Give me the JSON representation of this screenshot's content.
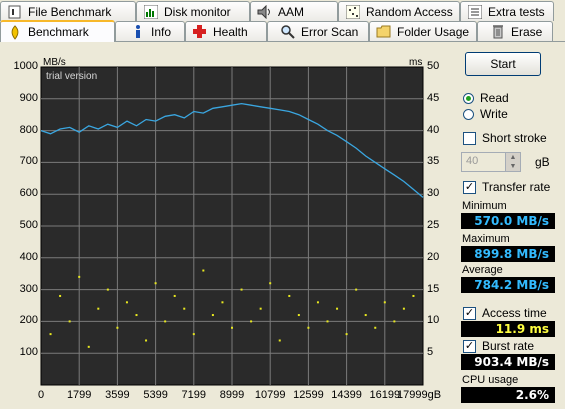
{
  "tabs_top": [
    {
      "label": "File Benchmark",
      "icon": "file-benchmark-icon"
    },
    {
      "label": "Disk monitor",
      "icon": "disk-monitor-icon"
    },
    {
      "label": "AAM",
      "icon": "speaker-icon"
    },
    {
      "label": "Random Access",
      "icon": "random-access-icon"
    },
    {
      "label": "Extra tests",
      "icon": "extra-tests-icon"
    }
  ],
  "tabs_bottom": [
    {
      "label": "Benchmark",
      "icon": "benchmark-icon",
      "active": true
    },
    {
      "label": "Info",
      "icon": "info-icon"
    },
    {
      "label": "Health",
      "icon": "health-cross-icon"
    },
    {
      "label": "Error Scan",
      "icon": "magnifier-icon"
    },
    {
      "label": "Folder Usage",
      "icon": "folder-icon"
    },
    {
      "label": "Erase",
      "icon": "trash-icon"
    }
  ],
  "chart": {
    "watermark": "trial version",
    "left_unit": "MB/s",
    "right_unit": "ms",
    "left_ticks": [
      "1000",
      "900",
      "800",
      "700",
      "600",
      "500",
      "400",
      "300",
      "200",
      "100"
    ],
    "right_ticks": [
      "50",
      "45",
      "40",
      "35",
      "30",
      "25",
      "20",
      "15",
      "10",
      "5"
    ],
    "x_ticks": [
      "0",
      "1799",
      "3599",
      "5399",
      "7199",
      "8999",
      "10799",
      "12599",
      "14399",
      "16199",
      "17999gB"
    ]
  },
  "chart_data": {
    "type": "line",
    "xlabel": "gB",
    "ylabel_left": "MB/s",
    "ylabel_right": "ms",
    "xlim": [
      0,
      18000
    ],
    "ylim_left": [
      0,
      1000
    ],
    "ylim_right": [
      0,
      50
    ],
    "grid": true,
    "series": [
      {
        "name": "Transfer rate",
        "axis": "left",
        "color": "#3aa6e0",
        "x": [
          0,
          450,
          900,
          1350,
          1800,
          2250,
          2700,
          3150,
          3600,
          4050,
          4500,
          4950,
          5400,
          5850,
          6300,
          6750,
          7200,
          7650,
          8100,
          8550,
          9000,
          9450,
          9900,
          10350,
          10800,
          11250,
          11700,
          12150,
          12600,
          13050,
          13500,
          13950,
          14400,
          14850,
          15300,
          15750,
          16200,
          16650,
          17100,
          17550,
          18000
        ],
        "y": [
          800,
          790,
          805,
          810,
          795,
          815,
          805,
          820,
          810,
          830,
          815,
          835,
          830,
          845,
          850,
          840,
          860,
          855,
          870,
          875,
          880,
          885,
          880,
          875,
          870,
          865,
          860,
          850,
          835,
          820,
          800,
          785,
          765,
          745,
          720,
          700,
          680,
          660,
          640,
          615,
          590
        ]
      },
      {
        "name": "Access time",
        "axis": "right",
        "color": "#e8e820",
        "type": "scatter",
        "x": [
          450,
          900,
          1350,
          1800,
          2250,
          2700,
          3150,
          3600,
          4050,
          4500,
          4950,
          5400,
          5850,
          6300,
          6750,
          7200,
          7650,
          8100,
          8550,
          9000,
          9450,
          9900,
          10350,
          10800,
          11250,
          11700,
          12150,
          12600,
          13050,
          13500,
          13950,
          14400,
          14850,
          15300,
          15750,
          16200,
          16650,
          17100,
          17550
        ],
        "y": [
          8,
          14,
          10,
          17,
          6,
          12,
          15,
          9,
          13,
          11,
          7,
          16,
          10,
          14,
          12,
          8,
          18,
          11,
          13,
          9,
          15,
          10,
          12,
          16,
          7,
          14,
          11,
          9,
          13,
          10,
          12,
          8,
          15,
          11,
          9,
          13,
          10,
          12,
          14
        ]
      }
    ]
  },
  "side": {
    "start": "Start",
    "read": "Read",
    "write": "Write",
    "short_stroke": "Short stroke",
    "stroke_value": "40",
    "stroke_unit": "gB",
    "transfer_rate": "Transfer rate",
    "minimum_label": "Minimum",
    "minimum": "570.0 MB/s",
    "maximum_label": "Maximum",
    "maximum": "899.8 MB/s",
    "average_label": "Average",
    "average": "784.2 MB/s",
    "access_time_label": "Access time",
    "access_time": "11.9 ms",
    "burst_rate_label": "Burst rate",
    "burst_rate": "903.4 MB/s",
    "cpu_label": "CPU usage",
    "cpu": "2.6%"
  }
}
